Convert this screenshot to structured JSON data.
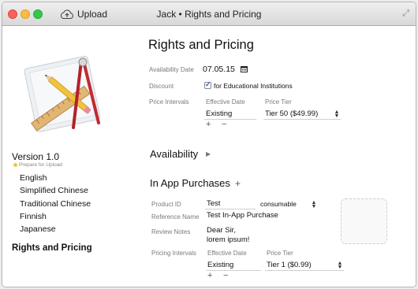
{
  "window": {
    "title": "Jack • Rights and Pricing",
    "upload_label": "Upload",
    "fullscreen_icon": "⤢"
  },
  "sidebar": {
    "version": "Version 1.0",
    "status": "Prepare for Upload",
    "status_color": "#f3c63f",
    "languages": [
      "English",
      "Simplified Chinese",
      "Traditional Chinese",
      "Finnish",
      "Japanese"
    ],
    "section": "Rights and Pricing"
  },
  "main": {
    "title": "Rights and Pricing",
    "availability_date_label": "Availability Date",
    "availability_date": "07.05.15",
    "discount_label": "Discount",
    "discount_text": "for Educational Institutions",
    "price_intervals_label": "Price Intervals",
    "effective_date_header": "Effective Date",
    "price_tier_header": "Price Tier",
    "effective_value": "Existing",
    "tier_value": "Tier 50 ($49.99)",
    "plus": "+",
    "minus": "−",
    "availability_section": "Availability",
    "disclosure": "▶",
    "iap_section": "In App Purchases",
    "iap_add": "+"
  },
  "iap": {
    "product_id_label": "Product ID",
    "product_id": "Test",
    "type": "consumable",
    "reference_name_label": "Reference Name",
    "reference_name": "Test In-App Purchase",
    "review_notes_label": "Review Notes",
    "review_notes_line1": "Dear Sir,",
    "review_notes_line2": "lorem ipsum!",
    "pricing_intervals_label": "Pricing Intervals",
    "effective_date_header": "Effective Date",
    "price_tier_header": "Price Tier",
    "effective_value": "Existing",
    "tier_value": "Tier 1 ($0.99)",
    "plus": "+",
    "minus": "−"
  }
}
